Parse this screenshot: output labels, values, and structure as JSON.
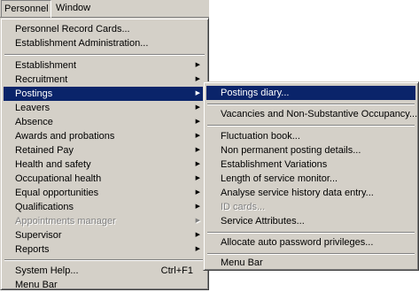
{
  "menubar": {
    "personnel_label": "Personnel",
    "window_label": "Window"
  },
  "personnel_menu": {
    "personnel_record_cards": "Personnel Record Cards...",
    "establishment_administration": "Establishment Administration...",
    "establishment": "Establishment",
    "recruitment": "Recruitment",
    "postings": "Postings",
    "leavers": "Leavers",
    "absence": "Absence",
    "awards_and_probations": "Awards and probations",
    "retained_pay": "Retained Pay",
    "health_and_safety": "Health and safety",
    "occupational_health": "Occupational health",
    "equal_opportunities": "Equal opportunities",
    "qualifications": "Qualifications",
    "appointments_manager": "Appointments manager",
    "supervisor": "Supervisor",
    "reports": "Reports",
    "system_help": "System Help...",
    "system_help_shortcut": "Ctrl+F1",
    "menu_bar": "Menu Bar"
  },
  "postings_submenu": {
    "postings_diary": "Postings diary...",
    "vacancies": "Vacancies and Non-Substantive Occupancy...",
    "fluctuation_book": "Fluctuation book...",
    "non_permanent_posting_details": "Non permanent posting details...",
    "establishment_variations": "Establishment Variations",
    "length_of_service_monitor": "Length of service monitor...",
    "analyse_service_history": "Analyse service history data entry...",
    "id_cards": "ID cards...",
    "service_attributes": "Service Attributes...",
    "allocate_auto_password": "Allocate auto password privileges...",
    "menu_bar": "Menu Bar"
  },
  "icons": {
    "submenu_arrow": "submenu-arrow-icon"
  },
  "colors": {
    "menu_background": "#d4d0c8",
    "highlight_background": "#0a246a",
    "highlight_text": "#ffffff",
    "disabled_text": "#808080"
  }
}
